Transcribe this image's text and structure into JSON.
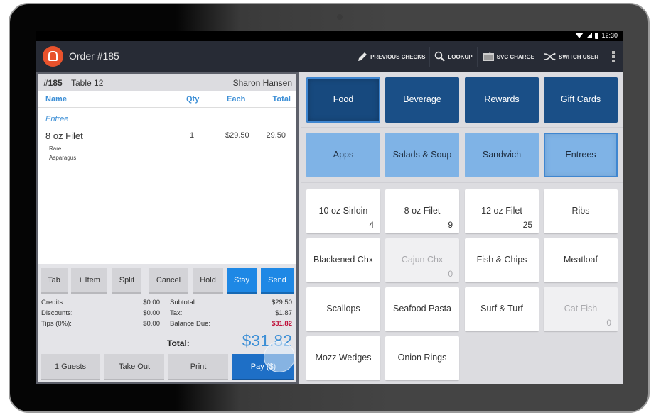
{
  "status_bar": {
    "time": "12:30",
    "icons": [
      "wifi-icon",
      "signal-icon",
      "battery-icon"
    ]
  },
  "app_bar": {
    "title": "Order #185",
    "actions": [
      {
        "icon": "pencil-icon",
        "label": "PREVIOUS CHECKS"
      },
      {
        "icon": "search-icon",
        "label": "LOOKUP"
      },
      {
        "icon": "card-icon",
        "label": "SVC CHARGE"
      },
      {
        "icon": "shuffle-icon",
        "label": "SWITCH USER"
      }
    ],
    "overflow_icon": "more-vert-icon"
  },
  "order": {
    "number": "#185",
    "table": "Table 12",
    "server": "Sharon Hansen",
    "columns": {
      "name": "Name",
      "qty": "Qty",
      "each": "Each",
      "total": "Total"
    },
    "category": "Entree",
    "items": [
      {
        "name": "8 oz Filet",
        "qty": "1",
        "each": "$29.50",
        "total": "29.50",
        "modifiers": [
          "Rare",
          "Asparagus"
        ]
      }
    ]
  },
  "action_buttons": [
    "Tab",
    "+ Item",
    "Split",
    "Cancel",
    "Hold",
    "Stay",
    "Send"
  ],
  "totals": {
    "credits_label": "Credits:",
    "credits": "$0.00",
    "discounts_label": "Discounts:",
    "discounts": "$0.00",
    "tips_label": "Tips (0%):",
    "tips": "$0.00",
    "subtotal_label": "Subtotal:",
    "subtotal": "$29.50",
    "tax_label": "Tax:",
    "tax": "$1.87",
    "balance_label": "Balance Due:",
    "balance": "$31.82",
    "total_label": "Total:",
    "total": "$31.82",
    "balance_color": "#c0143c"
  },
  "bottom_buttons": {
    "guests": "1 Guests",
    "takeout": "Take Out",
    "print": "Print",
    "pay": "Pay ($)"
  },
  "menu": {
    "top_categories": [
      {
        "label": "Food",
        "selected": true
      },
      {
        "label": "Beverage",
        "selected": false
      },
      {
        "label": "Rewards",
        "selected": false
      },
      {
        "label": "Gift Cards",
        "selected": false
      }
    ],
    "sub_categories": [
      {
        "label": "Apps",
        "selected": false
      },
      {
        "label": "Salads & Soup",
        "selected": false
      },
      {
        "label": "Sandwich",
        "selected": false
      },
      {
        "label": "Entrees",
        "selected": true
      }
    ],
    "items": [
      {
        "label": "10 oz Sirloin",
        "count": "4",
        "disabled": false
      },
      {
        "label": "8 oz Filet",
        "count": "9",
        "disabled": false
      },
      {
        "label": "12 oz Filet",
        "count": "25",
        "disabled": false
      },
      {
        "label": "Ribs",
        "count": "",
        "disabled": false
      },
      {
        "label": "Blackened Chx",
        "count": "",
        "disabled": false
      },
      {
        "label": "Cajun Chx",
        "count": "0",
        "disabled": true
      },
      {
        "label": "Fish & Chips",
        "count": "",
        "disabled": false
      },
      {
        "label": "Meatloaf",
        "count": "",
        "disabled": false
      },
      {
        "label": "Scallops",
        "count": "",
        "disabled": false
      },
      {
        "label": "Seafood Pasta",
        "count": "",
        "disabled": false
      },
      {
        "label": "Surf & Turf",
        "count": "",
        "disabled": false
      },
      {
        "label": "Cat Fish",
        "count": "0",
        "disabled": true
      },
      {
        "label": "Mozz Wedges",
        "count": "",
        "disabled": false
      },
      {
        "label": "Onion Rings",
        "count": "",
        "disabled": false
      }
    ]
  },
  "colors": {
    "accent": "#1e88e5",
    "pay": "#1e6fc6",
    "category_dark": "#1a4f87",
    "category_light": "#7fb3e6",
    "logo": "#e8522c"
  }
}
